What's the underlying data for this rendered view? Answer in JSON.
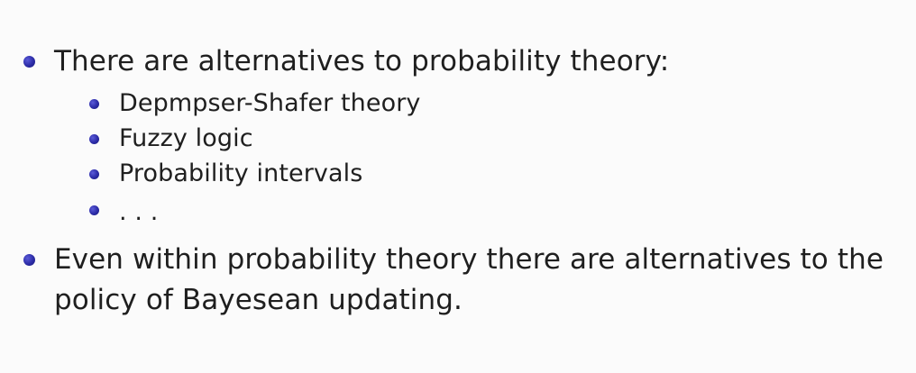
{
  "slide": {
    "items": [
      {
        "text": "There are alternatives to probability theory:",
        "subitems": [
          "Depmpser-Shafer theory",
          "Fuzzy logic",
          "Probability intervals",
          ". . ."
        ]
      },
      {
        "lines": [
          "Even within probability theory there are alternatives to the",
          "policy of Bayesean updating."
        ]
      }
    ]
  },
  "colors": {
    "bullet": "#2b2ba6",
    "text": "#1f1f1f",
    "background": "#fbfbfb"
  },
  "icons": {
    "bullet": "bullet-icon"
  }
}
